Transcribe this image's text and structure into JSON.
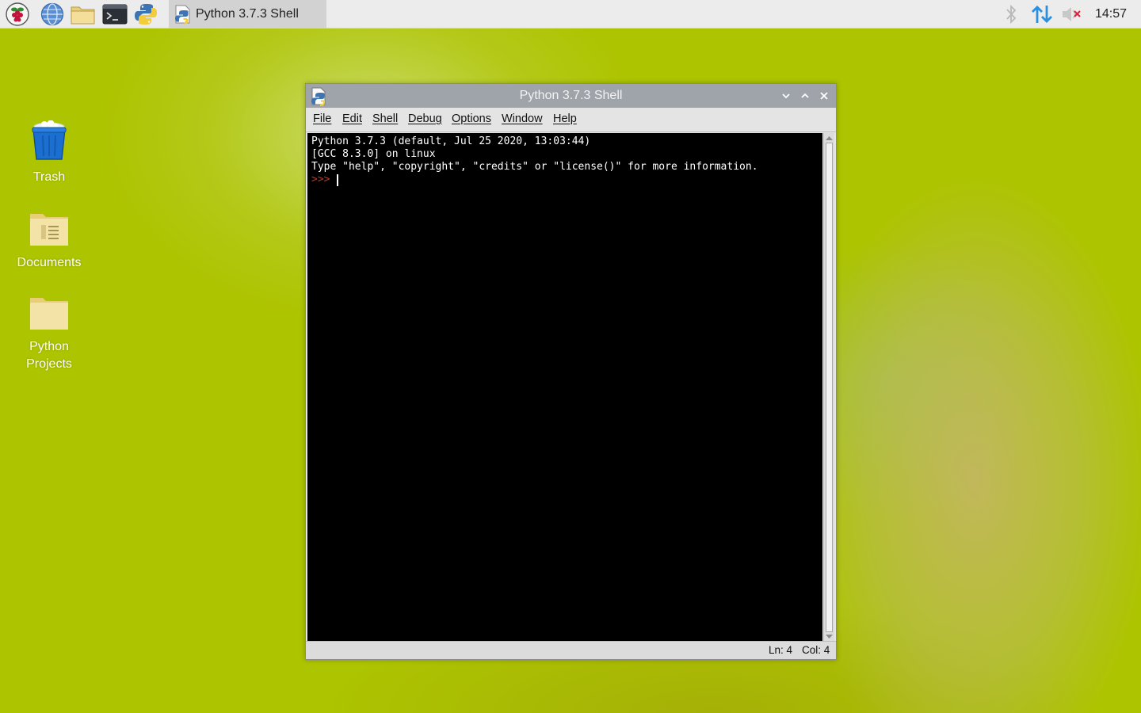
{
  "taskbar": {
    "launchers": [
      {
        "name": "raspberry-menu-icon"
      },
      {
        "name": "web-browser-icon"
      },
      {
        "name": "file-manager-icon"
      },
      {
        "name": "terminal-icon"
      },
      {
        "name": "python-idle-icon"
      }
    ],
    "task_label": "Python 3.7.3 Shell",
    "clock": "14:57",
    "tray": [
      "bluetooth-icon",
      "network-updown-icon",
      "volume-muted-icon"
    ]
  },
  "desktop": {
    "icons": [
      {
        "label": "Trash",
        "icon": "trash-icon"
      },
      {
        "label": "Documents",
        "icon": "documents-folder-icon"
      },
      {
        "label": "Python Projects",
        "icon": "folder-icon"
      }
    ]
  },
  "window": {
    "title": "Python 3.7.3 Shell",
    "menu": [
      "File",
      "Edit",
      "Shell",
      "Debug",
      "Options",
      "Window",
      "Help"
    ],
    "shell_lines": [
      "Python 3.7.3 (default, Jul 25 2020, 13:03:44)",
      "[GCC 8.3.0] on linux",
      "Type \"help\", \"copyright\", \"credits\" or \"license()\" for more information."
    ],
    "prompt": ">>>",
    "status": {
      "line": "Ln: 4",
      "col": "Col: 4"
    }
  },
  "colors": {
    "desktop_bg": "#adc400",
    "taskbar_bg": "#ececec",
    "titlebar_bg": "#9ea4aa",
    "shell_bg": "#000000",
    "prompt": "#b33b2a"
  }
}
